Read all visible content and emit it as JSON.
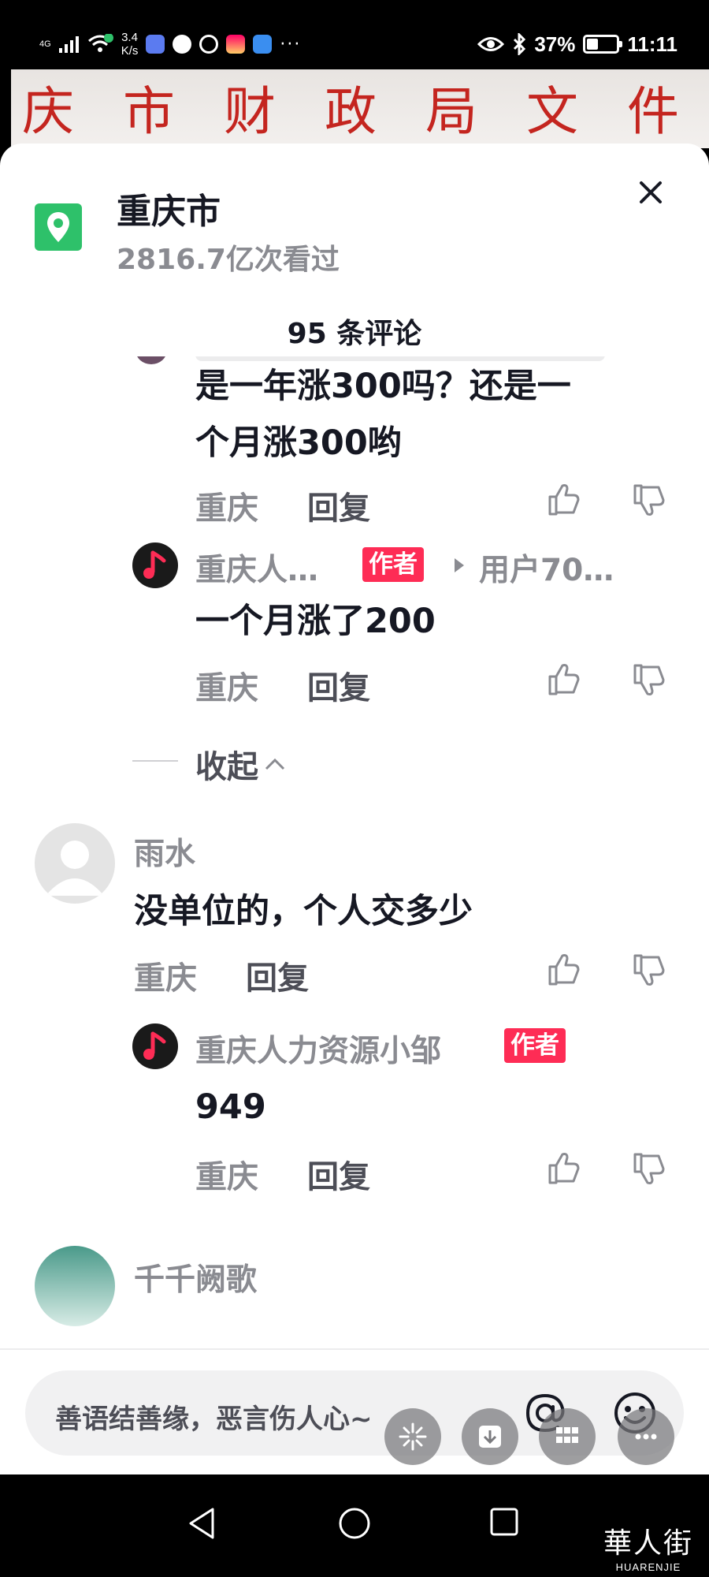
{
  "status_bar": {
    "network": "4G",
    "speed_value": "3.4",
    "speed_unit": "K/s",
    "battery": "37%",
    "battery_level": 0.37,
    "time": "11:11",
    "more": "···"
  },
  "background_video": {
    "text": "庆市财政局文件"
  },
  "location": {
    "title": "重庆市",
    "views": "2816.7亿次看过"
  },
  "comments_header": "95 条评论",
  "comments": [
    {
      "text": "是一年涨300吗？还是一个月涨300哟",
      "line1": "是一年涨300吗？还是一",
      "line2": "个月涨300哟",
      "location": "重庆",
      "reply_label": "回复"
    },
    {
      "author": "重庆人…",
      "badge": "作者",
      "reply_to": "用户70…",
      "text": "一个月涨了200",
      "location": "重庆",
      "reply_label": "回复"
    },
    {
      "collapse_label": "收起"
    },
    {
      "author": "雨水",
      "text": "没单位的，个人交多少",
      "location": "重庆",
      "reply_label": "回复"
    },
    {
      "author": "重庆人力资源小邹",
      "badge": "作者",
      "text": "949",
      "location": "重庆",
      "reply_label": "回复"
    },
    {
      "author": "千千阙歌"
    }
  ],
  "input": {
    "placeholder": "善语结善缘，恶言伤人心~"
  },
  "watermark": {
    "big": "華人街",
    "small": "HUARENJIE"
  },
  "colors": {
    "accent": "#fe2c55",
    "location_icon": "#2ec16a",
    "muted_text": "#8a8b91"
  }
}
